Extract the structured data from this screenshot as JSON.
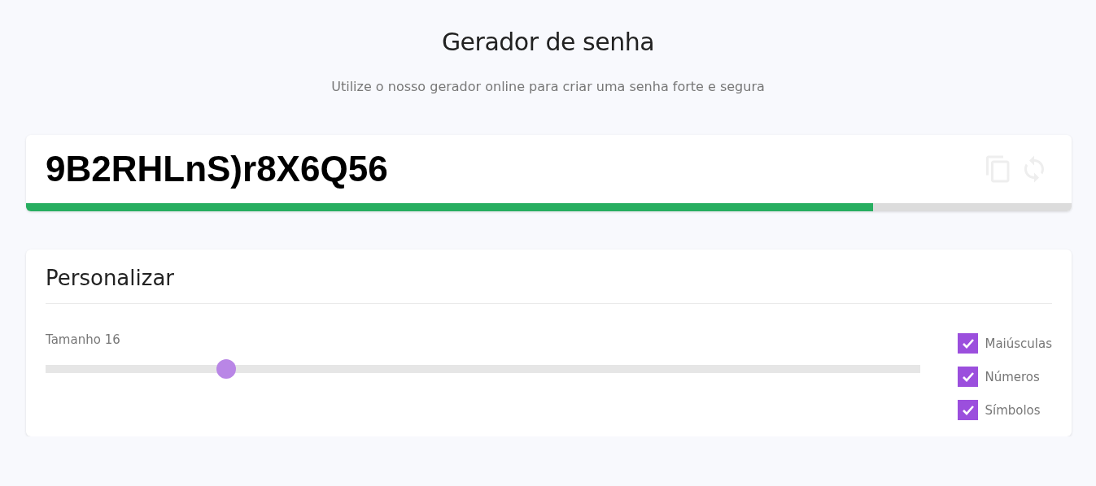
{
  "header": {
    "title": "Gerador de senha",
    "subtitle": "Utilize o nosso gerador online para criar uma senha forte e segura"
  },
  "password": {
    "value": "9B2RHLnS)r8X6Q56",
    "strength": {
      "level": 0.81
    }
  },
  "customize": {
    "title": "Personalizar",
    "length": {
      "label": "Tamanho 16",
      "level": 0.206
    },
    "options": [
      {
        "label": "Maiúsculas",
        "checked": true
      },
      {
        "label": "Números",
        "checked": true
      },
      {
        "label": "Símbolos",
        "checked": true
      }
    ]
  }
}
